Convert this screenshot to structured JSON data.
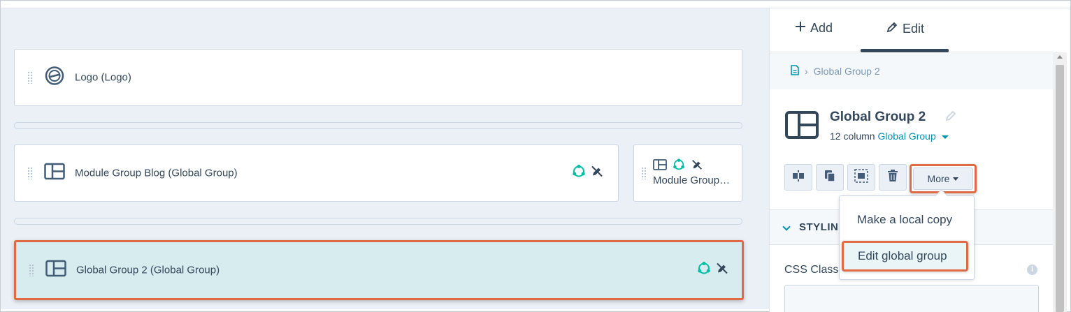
{
  "canvas": {
    "rows": [
      {
        "label": "Logo (Logo)",
        "icon": "logo-icon"
      },
      {
        "label": "Module Group Blog (Global Group)",
        "icon": "layout-icon"
      },
      {
        "label": "Global Group 2 (Global Group)",
        "icon": "layout-icon"
      }
    ],
    "side_card": {
      "label": "Module Group Blog (Global Group)"
    }
  },
  "sidebar": {
    "tabs": {
      "add": "Add",
      "edit": "Edit"
    },
    "breadcrumb": {
      "item": "Global Group 2"
    },
    "group": {
      "title": "Global Group 2",
      "sub_prefix": "12 column",
      "sub_link": "Global Group"
    },
    "toolbar": {
      "more_label": "More"
    },
    "section": {
      "styling_label": "STYLIN"
    },
    "css_class_label": "CSS Class"
  },
  "dropdown": {
    "items": [
      "Make a local copy",
      "Edit global group"
    ]
  },
  "colors": {
    "accent": "#0091ae",
    "highlight_border": "#e06a43",
    "selected_bg": "#d6ecef",
    "global_icon": "#00bda5",
    "text": "#33475b"
  }
}
